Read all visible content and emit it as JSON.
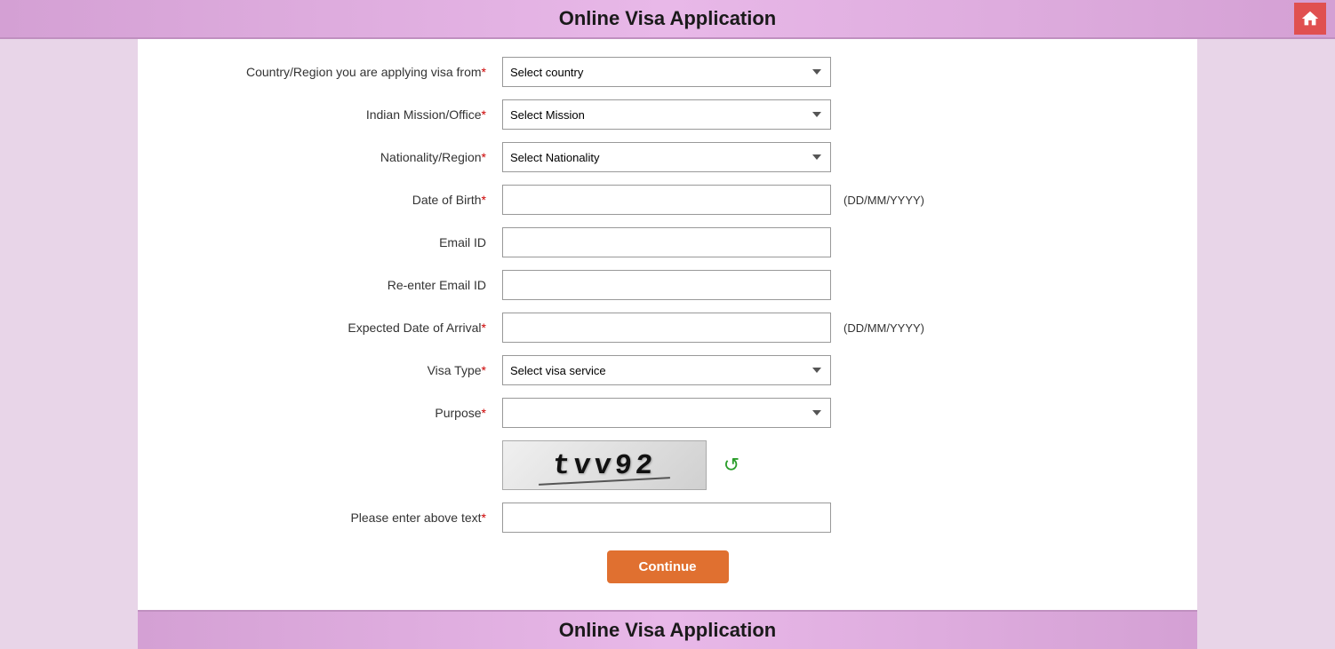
{
  "header": {
    "title": "Online Visa Application",
    "home_icon_label": "home"
  },
  "footer": {
    "title": "Online Visa Application"
  },
  "form": {
    "fields": [
      {
        "id": "country",
        "label": "Country/Region you are applying visa from",
        "required": true,
        "type": "select",
        "placeholder": "Select country",
        "hint": ""
      },
      {
        "id": "mission",
        "label": "Indian Mission/Office",
        "required": true,
        "type": "select",
        "placeholder": "Select Mission",
        "hint": ""
      },
      {
        "id": "nationality",
        "label": "Nationality/Region",
        "required": true,
        "type": "select",
        "placeholder": "Select Nationality",
        "hint": ""
      },
      {
        "id": "dob",
        "label": "Date of Birth",
        "required": true,
        "type": "text",
        "placeholder": "",
        "hint": "(DD/MM/YYYY)"
      },
      {
        "id": "email",
        "label": "Email ID",
        "required": false,
        "type": "text",
        "placeholder": "",
        "hint": ""
      },
      {
        "id": "re_email",
        "label": "Re-enter Email ID",
        "required": false,
        "type": "text",
        "placeholder": "",
        "hint": ""
      },
      {
        "id": "arrival_date",
        "label": "Expected Date of Arrival",
        "required": true,
        "type": "text",
        "placeholder": "",
        "hint": "(DD/MM/YYYY)"
      },
      {
        "id": "visa_type",
        "label": "Visa Type",
        "required": true,
        "type": "select",
        "placeholder": "Select visa service",
        "hint": ""
      },
      {
        "id": "purpose",
        "label": "Purpose",
        "required": true,
        "type": "select",
        "placeholder": "",
        "hint": ""
      }
    ],
    "captcha": {
      "text": "tvv92",
      "label": "Please enter above text",
      "required": true,
      "refresh_icon": "↻"
    },
    "continue_button": "Continue"
  }
}
